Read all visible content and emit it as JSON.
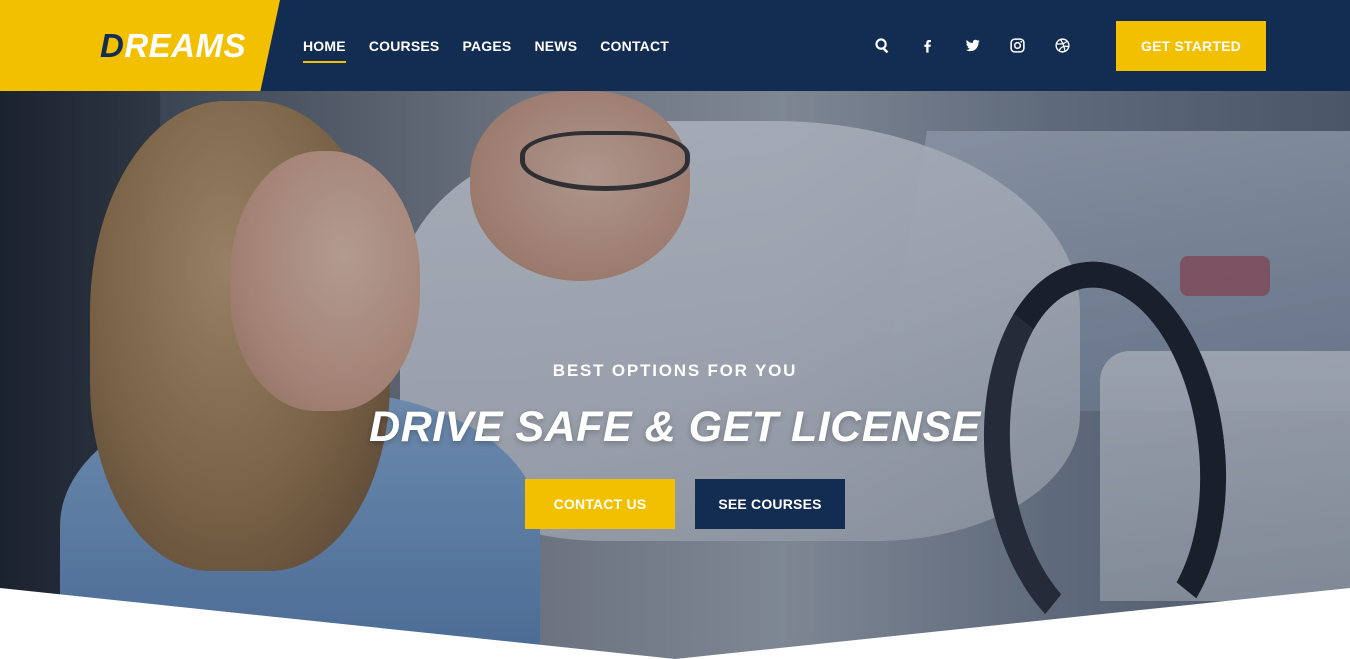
{
  "brand": {
    "first_letter": "D",
    "rest": "REAMS"
  },
  "nav": {
    "items": [
      {
        "label": "HOME",
        "active": true
      },
      {
        "label": "COURSES",
        "active": false
      },
      {
        "label": "PAGES",
        "active": false
      },
      {
        "label": "NEWS",
        "active": false
      },
      {
        "label": "CONTACT",
        "active": false
      }
    ]
  },
  "social": {
    "icons": [
      "search-icon",
      "facebook-icon",
      "twitter-icon",
      "instagram-icon",
      "dribbble-icon"
    ]
  },
  "header": {
    "cta_label": "GET STARTED"
  },
  "hero": {
    "subtitle": "BEST OPTIONS FOR YOU",
    "title": "DRIVE SAFE & GET LICENSE",
    "primary_button": "CONTACT US",
    "secondary_button": "SEE COURSES"
  },
  "colors": {
    "accent": "#f3c000",
    "navy": "#132c52",
    "white": "#ffffff"
  }
}
